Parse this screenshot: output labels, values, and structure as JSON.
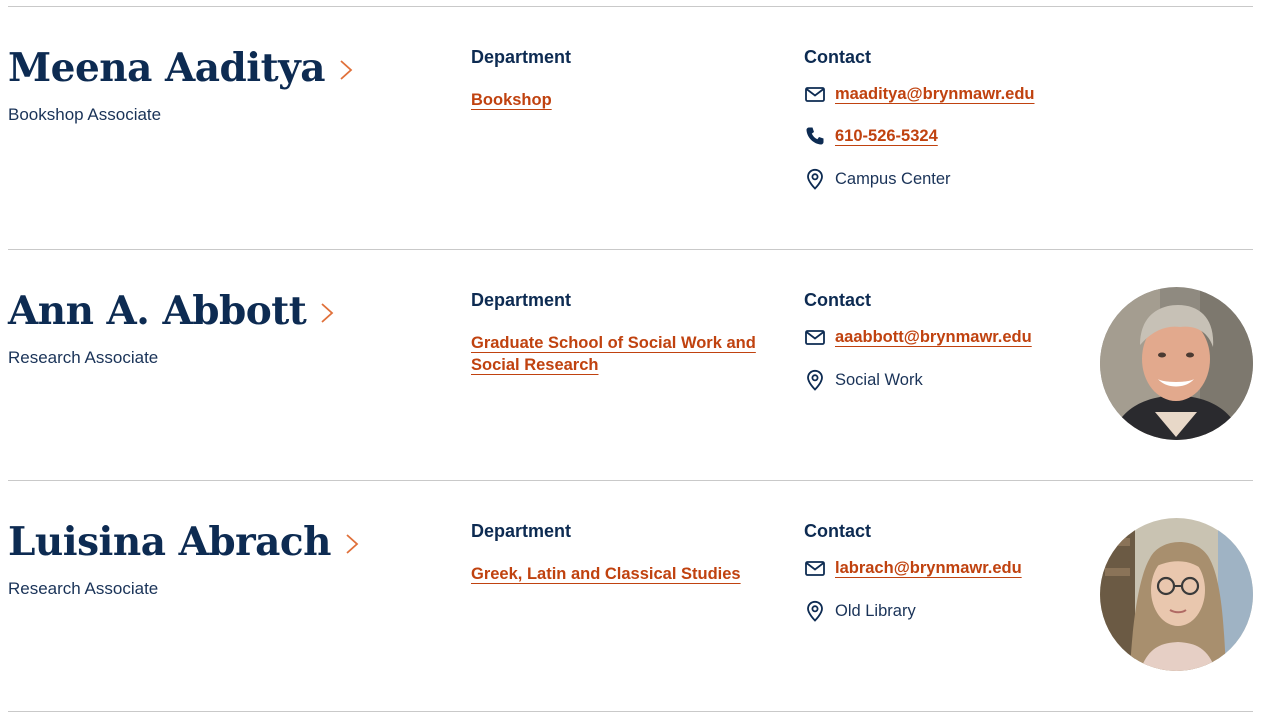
{
  "colors": {
    "navy": "#0d2b52",
    "accent": "#c0420f",
    "divider": "#c9c9c9"
  },
  "labels": {
    "department": "Department",
    "contact": "Contact"
  },
  "people": [
    {
      "name": "Meena Aaditya",
      "title": "Bookshop Associate",
      "department": "Bookshop",
      "email": "maaditya@brynmawr.edu",
      "phone": "610-526-5324",
      "location": "Campus Center",
      "photo": null
    },
    {
      "name": "Ann A. Abbott",
      "title": "Research Associate",
      "department": "Graduate School of Social Work and Social Research",
      "email": "aaabbott@brynmawr.edu",
      "phone": null,
      "location": "Social Work",
      "photo": "headshot-older-woman-short-gray-hair"
    },
    {
      "name": "Luisina Abrach",
      "title": "Research Associate",
      "department": "Greek, Latin and Classical Studies",
      "email": "labrach@brynmawr.edu",
      "phone": null,
      "location": "Old Library",
      "photo": "headshot-woman-long-hair-glasses"
    }
  ],
  "icons": {
    "email": "mail-icon",
    "phone": "phone-icon",
    "location": "map-pin-icon",
    "profile": "chevron-right-icon"
  }
}
